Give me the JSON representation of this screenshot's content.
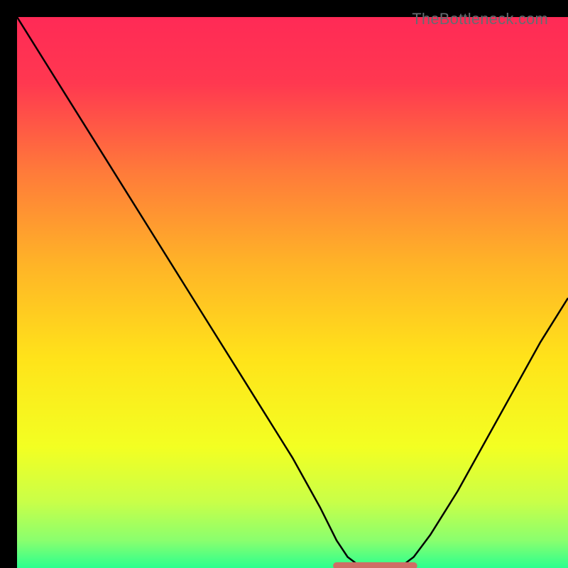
{
  "watermark": "TheBottleneck.com",
  "chart_data": {
    "type": "line",
    "title": "",
    "xlabel": "",
    "ylabel": "",
    "xlim": [
      0,
      100
    ],
    "ylim": [
      0,
      100
    ],
    "grid": false,
    "series": [
      {
        "name": "bottleneck-curve",
        "x": [
          0,
          5,
          10,
          15,
          20,
          25,
          30,
          35,
          40,
          45,
          50,
          55,
          58,
          60,
          62,
          64,
          66,
          68,
          70,
          72,
          75,
          80,
          85,
          90,
          95,
          100
        ],
        "values": [
          100,
          92,
          84,
          76,
          68,
          60,
          52,
          44,
          36,
          28,
          20,
          11,
          5,
          2,
          0.5,
          0.3,
          0.3,
          0.3,
          0.5,
          2,
          6,
          14,
          23,
          32,
          41,
          49
        ]
      }
    ],
    "flat_zone": {
      "x_start": 58,
      "x_end": 72,
      "y": 0.4,
      "stroke": "#cf6d66",
      "width": 10
    },
    "gradient_stops": [
      {
        "pct": 0.0,
        "color": "#ff2a56"
      },
      {
        "pct": 0.12,
        "color": "#ff3850"
      },
      {
        "pct": 0.28,
        "color": "#ff7a3a"
      },
      {
        "pct": 0.45,
        "color": "#ffb427"
      },
      {
        "pct": 0.62,
        "color": "#ffe31a"
      },
      {
        "pct": 0.78,
        "color": "#f3ff22"
      },
      {
        "pct": 0.88,
        "color": "#c9ff48"
      },
      {
        "pct": 0.95,
        "color": "#8aff6e"
      },
      {
        "pct": 1.0,
        "color": "#2bff8f"
      }
    ]
  }
}
